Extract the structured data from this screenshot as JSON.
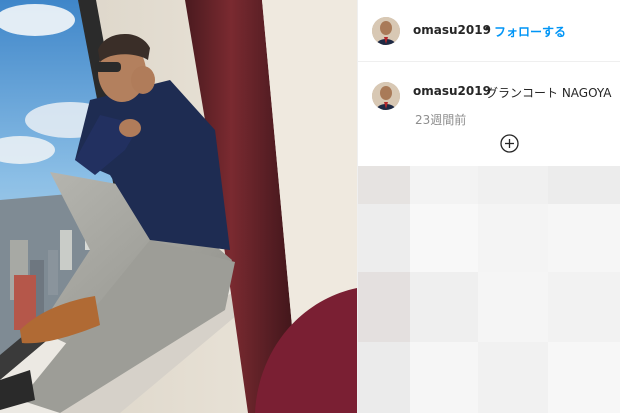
{
  "post": {
    "username": "omasu2019",
    "separator": "•",
    "follow_label": "フォローする",
    "caption_username": "omasu2019",
    "caption_text": "グランコート NAGOYA",
    "time_ago": "23週間前"
  },
  "icons": {
    "add": "add-circle-icon",
    "avatar": "profile-avatar"
  },
  "colors": {
    "link": "#0095f6",
    "text": "#262626",
    "muted": "#8e8e8e"
  }
}
